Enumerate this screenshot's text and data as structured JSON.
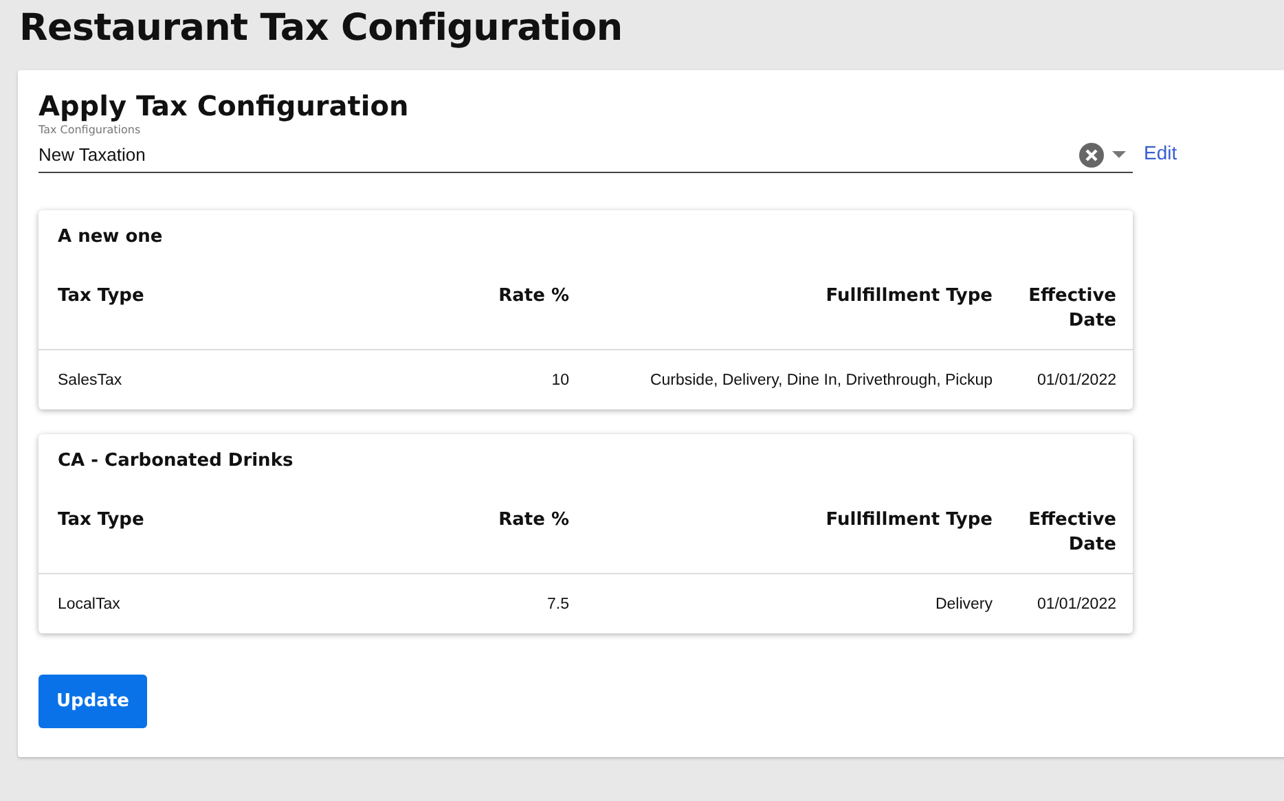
{
  "page_title": "Restaurant Tax Configuration",
  "panel": {
    "title": "Apply Tax Configuration",
    "field": {
      "label": "Tax Configurations",
      "value": "New Taxation"
    },
    "edit_link": "Edit",
    "tables": [
      {
        "title": "A new one",
        "columns": [
          "Tax Type",
          "Rate %",
          "Fullfillment Type",
          "Effective Date"
        ],
        "rows": [
          [
            "SalesTax",
            "10",
            "Curbside, Delivery, Dine In, Drivethrough, Pickup",
            "01/01/2022"
          ]
        ]
      },
      {
        "title": "CA - Carbonated Drinks",
        "columns": [
          "Tax Type",
          "Rate %",
          "Fullfillment Type",
          "Effective Date"
        ],
        "rows": [
          [
            "LocalTax",
            "7.5",
            "Delivery",
            "01/01/2022"
          ]
        ]
      }
    ],
    "button": "Update"
  }
}
